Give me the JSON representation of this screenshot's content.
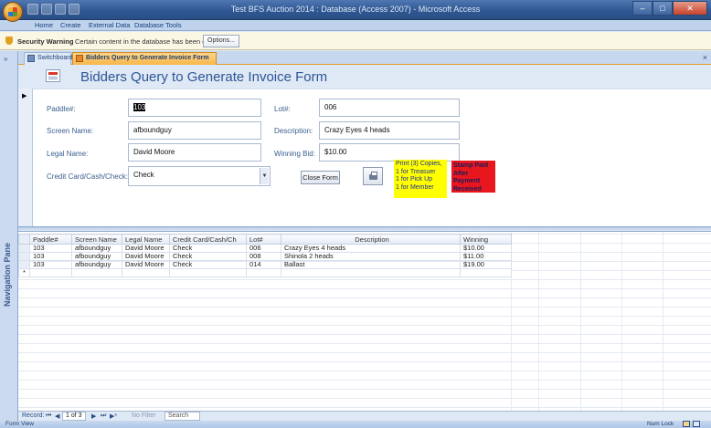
{
  "window": {
    "title": "Test BFS Auction 2014 : Database (Access 2007) - Microsoft Access",
    "minimize": "–",
    "maximize": "□",
    "close": "✕"
  },
  "ribbon": {
    "tabs": [
      "Home",
      "Create",
      "External Data",
      "Database Tools"
    ]
  },
  "security": {
    "title": "Security Warning",
    "message": "Certain content in the database has been disabled",
    "options_label": "Options..."
  },
  "nav_pane": {
    "label": "Navigation Pane",
    "chevron": "»"
  },
  "doc_tabs": [
    {
      "label": "Switchboard",
      "active": false
    },
    {
      "label": "Bidders Query to Generate Invoice Form",
      "active": true
    }
  ],
  "doc_close": "×",
  "form": {
    "title": "Bidders Query to Generate Invoice Form",
    "record_arrow": "▶",
    "fields": {
      "paddle_label": "Paddle#:",
      "paddle_value": "103",
      "screen_name_label": "Screen Name:",
      "screen_name_value": "afboundguy",
      "legal_name_label": "Legal Name:",
      "legal_name_value": "David Moore",
      "payment_label": "Credit Card/Cash/Check:",
      "payment_value": "Check",
      "lot_label": "Lot#:",
      "lot_value": "006",
      "description_label": "Description:",
      "description_value": "Crazy Eyes 4 heads",
      "winning_bid_label": "Winning Bid:",
      "winning_bid_value": "$10.00"
    },
    "close_form_label": "Close Form",
    "combo_arrow": "▼",
    "note_yellow": [
      "Print (3) Copies,",
      "1 for Treasuer",
      "1 for Pick Up",
      "1 for Member"
    ],
    "note_red": [
      "Stamp Paid",
      "After Payment",
      "Received"
    ],
    "colors": {
      "yellow_note": "#ffff00",
      "red_note": "#e8171e",
      "title": "#2c5696"
    }
  },
  "datasheet": {
    "columns": [
      "Paddle#",
      "Screen Name",
      "Legal Name",
      "Credit Card/Cash/Ch",
      "Lot#",
      "Description",
      "Winning"
    ],
    "rows": [
      [
        "103",
        "afboundguy",
        "David Moore",
        "Check",
        "006",
        "Crazy Eyes 4 heads",
        "$10.00"
      ],
      [
        "103",
        "afboundguy",
        "David Moore",
        "Check",
        "008",
        "Shinola 2 heads",
        "$11.00"
      ],
      [
        "103",
        "afboundguy",
        "David Moore",
        "Check",
        "014",
        "Ballast",
        "$19.00"
      ]
    ],
    "new_row_marker": "*"
  },
  "record_nav": {
    "label": "Record:",
    "first": "⏮",
    "prev": "◀",
    "position": "1 of 3",
    "next": "▶",
    "last": "⏭",
    "new": "▶*",
    "filter": "No Filter",
    "search": "Search"
  },
  "status": {
    "left": "Form View",
    "right": "Num Lock"
  }
}
